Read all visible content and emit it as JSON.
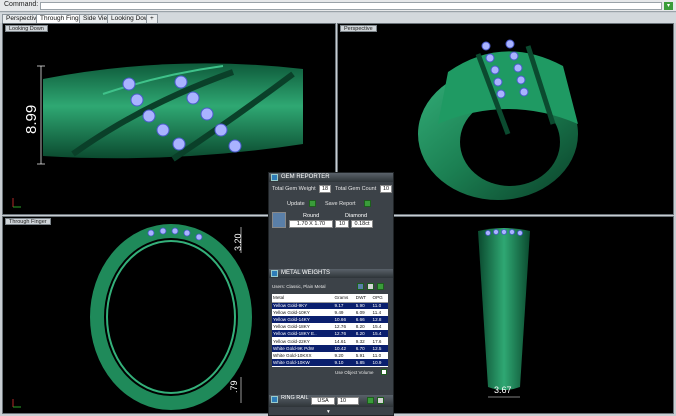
{
  "command": {
    "label": "Command:"
  },
  "tabs": [
    "Perspective",
    "Through Finger",
    "Side View",
    "Looking Down",
    "+"
  ],
  "viewports": {
    "top_left": {
      "label": "Looking Down",
      "dimension": "8.99"
    },
    "top_right": {
      "label": "Perspective"
    },
    "bottom_left": {
      "label": "Through Finger",
      "dim_top": "3.20",
      "dim_bottom": ".79"
    },
    "bottom_right": {
      "dimension": "3.67"
    }
  },
  "gem_reporter": {
    "title": "GEM REPORTER",
    "weight_label": "Total Gem Weight",
    "weight_value": "18",
    "count_label": "Total Gem Count",
    "count_value": "10",
    "update_label": "Update",
    "save_label": "Save Report",
    "col_round": "Round",
    "col_diamond": "Diamond",
    "row_size": "1.70 X 1.70",
    "row_count": "10",
    "row_weight": "0.18ct"
  },
  "metal_weights": {
    "title": "METAL WEIGHTS",
    "subtitle": "Users: Classic, Plain Metal",
    "headers": [
      "Metal",
      "Grams",
      "DWT",
      "OPG"
    ],
    "rows": [
      [
        "Yellow Gold-9KY",
        "9.17",
        "5.90",
        "11.0"
      ],
      [
        "Yellow Gold-10KY",
        "9.49",
        "6.09",
        "11.4"
      ],
      [
        "Yellow Gold-14KY",
        "10.66",
        "6.66",
        "12.8"
      ],
      [
        "Yellow Gold-18KY",
        "12.76",
        "8.20",
        "15.4"
      ],
      [
        "Yellow Gold-18KY E..",
        "12.76",
        "8.20",
        "15.4"
      ],
      [
        "Yellow Gold-22KY",
        "14.61",
        "9.32",
        "17.6"
      ],
      [
        "White Gold-9K PdW",
        "10.42",
        "6.70",
        "12.5"
      ],
      [
        "White Gold-10KXX",
        "9.20",
        "5.91",
        "11.0"
      ],
      [
        "White Gold-10KW",
        "9.10",
        "5.85",
        "10.9"
      ],
      [
        "White Gold-14KXX",
        "10.44",
        "6.71",
        "12.5"
      ],
      [
        "White Gold-14K PdW",
        "11.89",
        "7.65",
        "14.3"
      ]
    ],
    "option_label": "Use Object Volume"
  },
  "ring_rail": {
    "title": "RING RAIL",
    "country": "USA",
    "size": "10"
  },
  "colors": {
    "ring_green": "#1f8a5a",
    "gem_blue": "#9aa8ff",
    "viewport_bg": "#000000"
  }
}
